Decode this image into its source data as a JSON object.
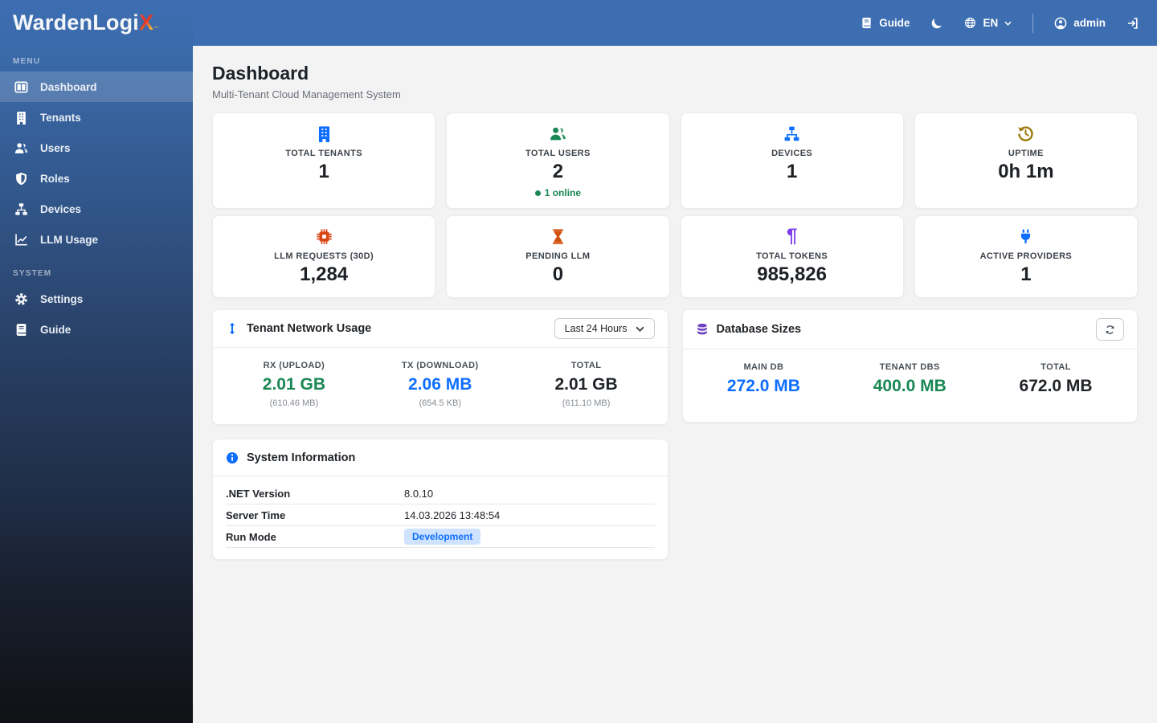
{
  "brand": {
    "name": "WardenLogi",
    "x": "X",
    "tm": "™"
  },
  "topbar": {
    "guide_label": "Guide",
    "language": "EN",
    "username": "admin"
  },
  "sidebar": {
    "menu_label": "MENU",
    "system_label": "SYSTEM",
    "items": [
      {
        "label": "Dashboard",
        "icon": "dashboard-icon",
        "active": true
      },
      {
        "label": "Tenants",
        "icon": "building-icon",
        "active": false
      },
      {
        "label": "Users",
        "icon": "users-icon",
        "active": false
      },
      {
        "label": "Roles",
        "icon": "shield-icon",
        "active": false
      },
      {
        "label": "Devices",
        "icon": "sitemap-icon",
        "active": false
      },
      {
        "label": "LLM Usage",
        "icon": "chart-line-icon",
        "active": false
      }
    ],
    "system_items": [
      {
        "label": "Settings",
        "icon": "gear-icon"
      },
      {
        "label": "Guide",
        "icon": "book-icon"
      }
    ]
  },
  "page": {
    "title": "Dashboard",
    "subtitle": "Multi-Tenant Cloud Management System"
  },
  "stat_cards": [
    {
      "label": "TOTAL TENANTS",
      "value": "1",
      "icon": "building-icon",
      "icon_color": "#0d6efd"
    },
    {
      "label": "TOTAL USERS",
      "value": "2",
      "icon": "users-icon",
      "icon_color": "#198754",
      "sub": "1 online",
      "sub_color": "#198754"
    },
    {
      "label": "DEVICES",
      "value": "1",
      "icon": "sitemap-icon",
      "icon_color": "#0d6efd"
    },
    {
      "label": "UPTIME",
      "value": "0h 1m",
      "icon": "clock-history-icon",
      "icon_color": "#9a7a0a"
    },
    {
      "label": "LLM REQUESTS (30D)",
      "value": "1,284",
      "icon": "cpu-chip-icon",
      "icon_color": "#da4413"
    },
    {
      "label": "PENDING LLM",
      "value": "0",
      "icon": "hourglass-icon",
      "icon_color": "#d1520f"
    },
    {
      "label": "TOTAL TOKENS",
      "value": "985,826",
      "icon": "pilcrow-icon",
      "icon_color": "#7c3aed"
    },
    {
      "label": "ACTIVE PROVIDERS",
      "value": "1",
      "icon": "plug-icon",
      "icon_color": "#0d6efd"
    }
  ],
  "network_panel": {
    "title": "Tenant Network Usage",
    "range_selected": "Last 24 Hours",
    "columns": [
      {
        "label": "RX (UPLOAD)",
        "value": "2.01 GB",
        "sub": "(610.46 MB)",
        "color": "#198754"
      },
      {
        "label": "TX (DOWNLOAD)",
        "value": "2.06 MB",
        "sub": "(654.5 KB)",
        "color": "#0d6efd"
      },
      {
        "label": "TOTAL",
        "value": "2.01 GB",
        "sub": "(611.10 MB)",
        "color": "#212529"
      }
    ]
  },
  "database_panel": {
    "title": "Database Sizes",
    "columns": [
      {
        "label": "MAIN DB",
        "value": "272.0 MB",
        "color": "#0d6efd"
      },
      {
        "label": "TENANT DBS",
        "value": "400.0 MB",
        "color": "#198754"
      },
      {
        "label": "TOTAL",
        "value": "672.0 MB",
        "color": "#212529"
      }
    ]
  },
  "system_info": {
    "title": "System Information",
    "rows": [
      {
        "label": ".NET Version",
        "value": "8.0.10"
      },
      {
        "label": "Server Time",
        "value": "14.03.2026 13:48:54"
      },
      {
        "label": "Run Mode",
        "value": "Development"
      }
    ]
  },
  "colors": {
    "header_blue": "#3d6eb2",
    "sidebar_bottom": "#101115",
    "success_green": "#198754",
    "primary_blue": "#0d6efd",
    "content_bg": "#f3f3f4"
  }
}
